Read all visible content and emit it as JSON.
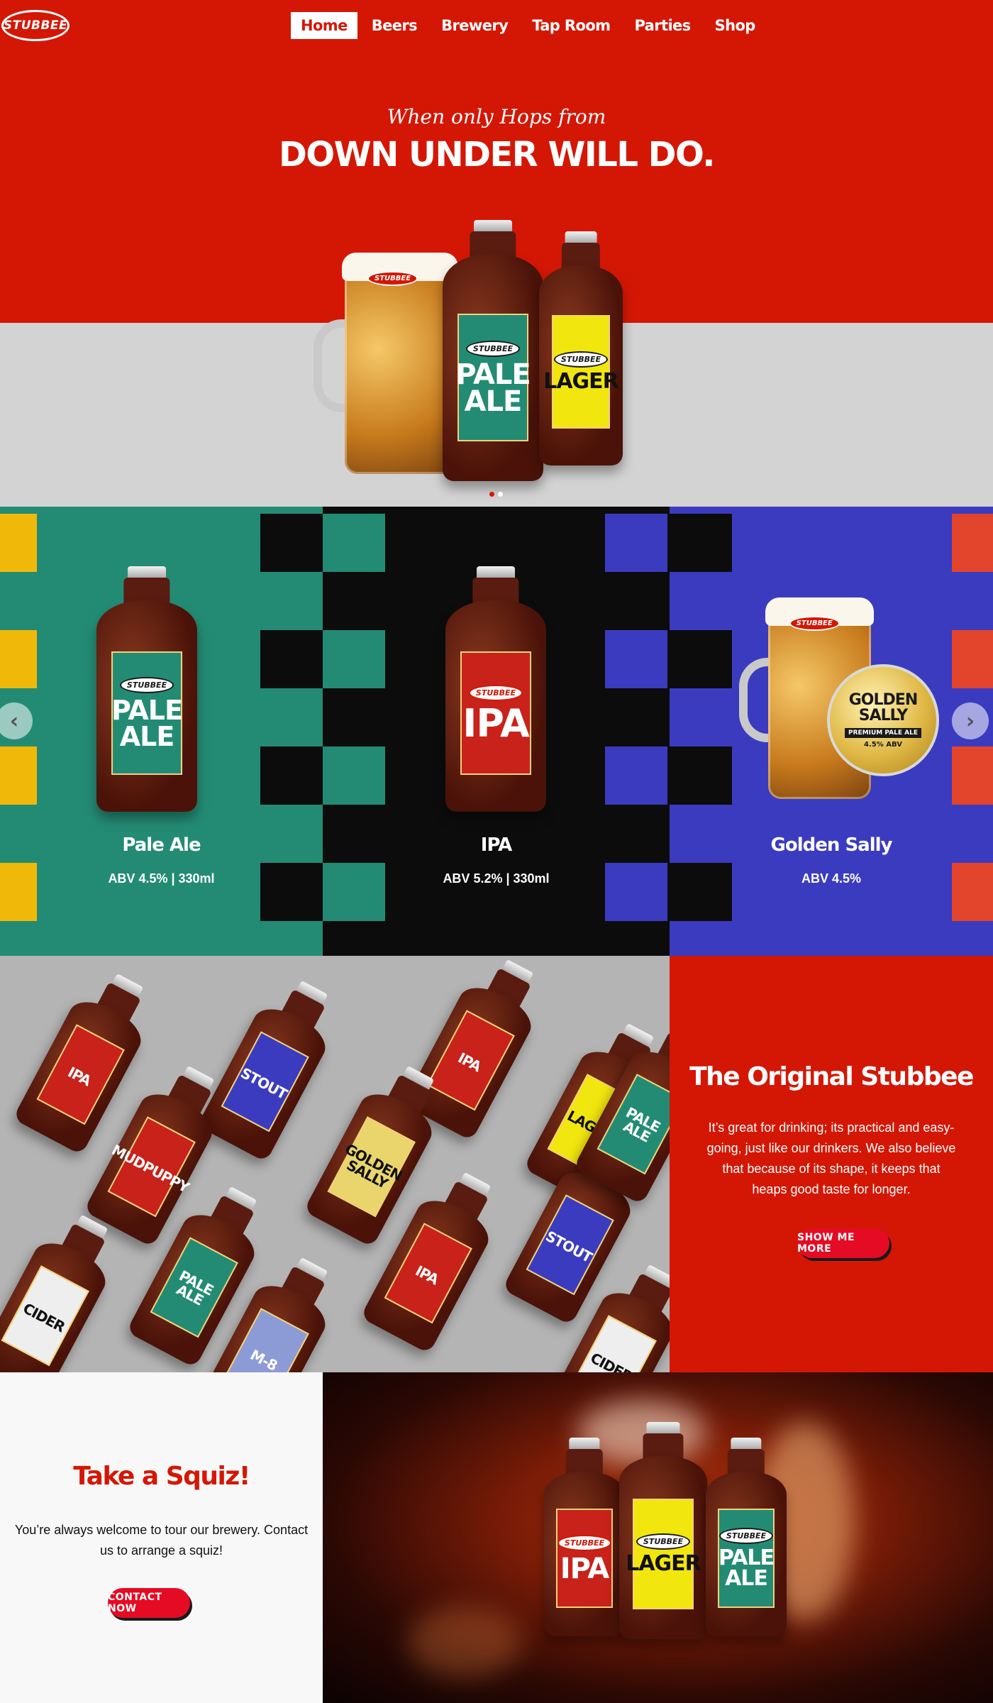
{
  "brand": {
    "logo_text": "STUBBEE"
  },
  "nav": {
    "items": [
      {
        "label": "Home",
        "active": true
      },
      {
        "label": "Beers",
        "active": false
      },
      {
        "label": "Brewery",
        "active": false
      },
      {
        "label": "Tap Room",
        "active": false
      },
      {
        "label": "Parties",
        "active": false
      },
      {
        "label": "Shop",
        "active": false
      }
    ]
  },
  "hero": {
    "script": "When only Hops from",
    "title": "DOWN UNDER WILL DO.",
    "mug_badge": "STUBBEE",
    "bottle_pale": {
      "brand": "STUBBEE",
      "name_line1": "PALE",
      "name_line2": "ALE"
    },
    "bottle_lager": {
      "brand": "STUBBEE",
      "name": "LAGER"
    },
    "slide_count": 2,
    "active_slide": 1
  },
  "beers": [
    {
      "title": "Pale Ale",
      "sub": "ABV 4.5% | 330ml",
      "label_line1": "PALE",
      "label_line2": "ALE",
      "brand": "STUBBEE"
    },
    {
      "title": "IPA",
      "sub": "ABV 5.2% | 330ml",
      "label_line1": "IPA",
      "brand": "STUBBEE"
    },
    {
      "title": "Golden Sally",
      "sub": "ABV 4.5%",
      "medal_line1": "GOLDEN",
      "medal_line2": "SALLY",
      "medal_tag": "PREMIUM PALE ALE",
      "medal_abv": "4.5% ABV",
      "mug_badge": "STUBBEE"
    }
  ],
  "carousel": {
    "prev_icon": "chevron-left-icon",
    "next_icon": "chevron-right-icon"
  },
  "original": {
    "title": "The Original Stubbee",
    "body": "It’s great for drinking; its practical and easy-going, just like our drinkers. We also believe that because of its shape, it keeps that heaps good taste for longer.",
    "button": "SHOW ME MORE",
    "bottle_labels": [
      "IPA",
      "STOUT",
      "IPA",
      "LAGER",
      "MUDPUPPY",
      "GOLDEN SALLY",
      "PALE ALE",
      "IPA",
      "STOUT",
      "CIDER",
      "M-8",
      "CIDER",
      "PALE ALE"
    ]
  },
  "squiz": {
    "title": "Take a Squiz!",
    "body": "You’re always welcome to tour our brewery. Contact us to arrange a squiz!",
    "button": "CONTACT NOW",
    "bottles": [
      {
        "brand": "STUBBEE",
        "name": "IPA"
      },
      {
        "brand": "STUBBEE",
        "name": "LAGER"
      },
      {
        "brand": "STUBBEE",
        "name_line1": "PALE",
        "name_line2": "ALE"
      }
    ]
  },
  "colors": {
    "brand_red": "#d41705",
    "button_red": "#e50b24",
    "pale_green": "#238b74",
    "ipa_black": "#0c0c0c",
    "sally_blue": "#3b3bc0",
    "hero_grey": "#d3d3d3",
    "lager_yellow": "#f2e60f",
    "ipa_label_red": "#c8221a"
  }
}
